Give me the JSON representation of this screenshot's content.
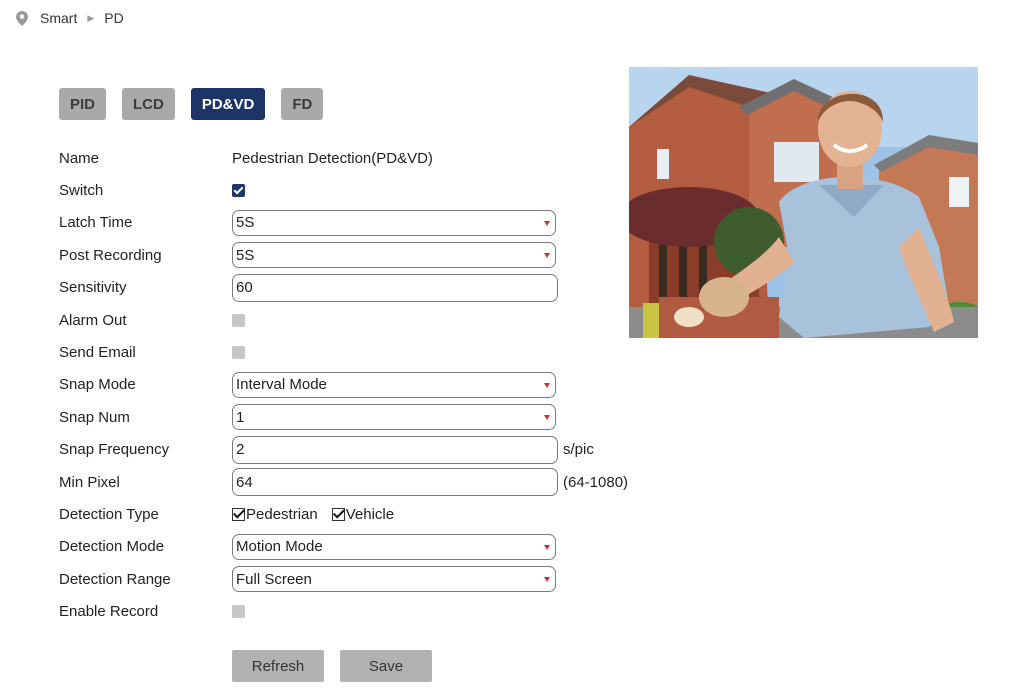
{
  "breadcrumb": [
    "Smart",
    "PD"
  ],
  "tabs": [
    {
      "label": "PID",
      "active": false
    },
    {
      "label": "LCD",
      "active": false
    },
    {
      "label": "PD&VD",
      "active": true
    },
    {
      "label": "FD",
      "active": false
    }
  ],
  "form": {
    "name": {
      "label": "Name",
      "value": "Pedestrian Detection(PD&VD)"
    },
    "switch": {
      "label": "Switch",
      "checked": true
    },
    "latch_time": {
      "label": "Latch Time",
      "value": "5S"
    },
    "post_recording": {
      "label": "Post Recording",
      "value": "5S"
    },
    "sensitivity": {
      "label": "Sensitivity",
      "value": "60"
    },
    "alarm_out": {
      "label": "Alarm Out",
      "checked": false
    },
    "send_email": {
      "label": "Send Email",
      "checked": false
    },
    "snap_mode": {
      "label": "Snap Mode",
      "value": "Interval Mode"
    },
    "snap_num": {
      "label": "Snap Num",
      "value": "1"
    },
    "snap_frequency": {
      "label": "Snap Frequency",
      "value": "2",
      "unit": "s/pic"
    },
    "min_pixel": {
      "label": "Min Pixel",
      "value": "64",
      "unit": "(64-1080)"
    },
    "detection_type": {
      "label": "Detection Type",
      "options": [
        {
          "label": "Pedestrian",
          "checked": true
        },
        {
          "label": "Vehicle",
          "checked": true
        }
      ]
    },
    "detection_mode": {
      "label": "Detection Mode",
      "value": "Motion Mode"
    },
    "detection_range": {
      "label": "Detection Range",
      "value": "Full Screen"
    },
    "enable_record": {
      "label": "Enable Record",
      "checked": false
    }
  },
  "buttons": {
    "refresh": "Refresh",
    "save": "Save"
  },
  "colors": {
    "accent": "#1c3566",
    "tab_inactive": "#a9a9a9",
    "button": "#b2b2b2",
    "arrow": "#c0392b"
  }
}
